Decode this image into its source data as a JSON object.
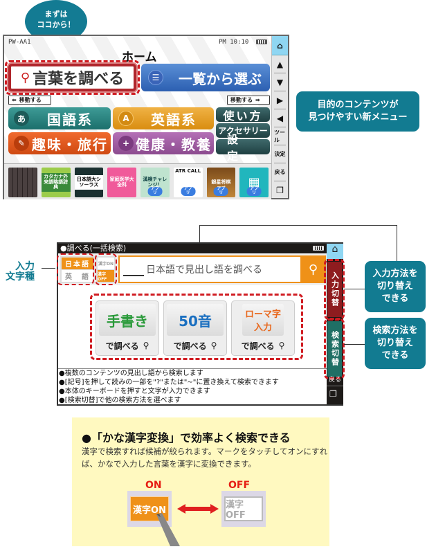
{
  "screen1": {
    "bubble_lines": [
      "まずは",
      "ココから！"
    ],
    "model": "PW-AA1",
    "time": "PM 10:10",
    "title": "ホーム",
    "search_button": "言葉を調べる",
    "list_button": "一覧から選ぶ",
    "move_left": "移動する",
    "move_right": "移動する",
    "categories": [
      {
        "icon": "あ",
        "label": "国語系"
      },
      {
        "icon": "A",
        "label": "英語系"
      },
      {
        "icon": "✎",
        "label": "趣味・旅行"
      },
      {
        "icon": "+",
        "label": "健康・教養"
      }
    ],
    "side_buttons": [
      "使い方",
      "アクセサリー",
      "設定"
    ],
    "shelf": [
      {
        "label": "",
        "app": ""
      },
      {
        "label": "カタカナ外来語略語辞典",
        "app": ""
      },
      {
        "label": "日本語大シソーラス",
        "app": ""
      },
      {
        "label": "家庭医学大全科",
        "app": ""
      },
      {
        "label": "漢検チャレンジ！",
        "app": "アプリ"
      },
      {
        "label": "ATR CALL",
        "app": "アプリ"
      },
      {
        "label": "銀星将棋",
        "app": "アプリ"
      },
      {
        "label": "",
        "app": "アプリ"
      }
    ],
    "sidebar": [
      "▲",
      "▼",
      "▶",
      "◀",
      "ツール",
      "決定",
      "戻る"
    ],
    "callout": [
      "目的のコンテンツが",
      "見つけやすい新メニュー"
    ]
  },
  "screen2": {
    "header": "●調べる(一括検索)",
    "label_input_type": [
      "入力",
      "文字種"
    ],
    "lang_japanese": "日本語",
    "lang_english": "英　語",
    "kanji_on": "漢字ON",
    "kanji_off": "漢字OFF",
    "search_placeholder": "日本語で見出し語を調べる",
    "methods": [
      {
        "label": "手書き",
        "action": "で調べる",
        "color": "#2a9a3a"
      },
      {
        "label": "50音",
        "action": "で調べる",
        "color": "#1a6fc0"
      },
      {
        "label": "ローマ字入力",
        "action": "で調べる",
        "color": "#e8661a"
      }
    ],
    "switch_input": "入力切替",
    "switch_search": "検索切替",
    "back": "戻る",
    "info": [
      "●複数のコンテンツの見出し語から検索します",
      "●[記号]を押して読みの一部を\"?\"または\"~\"に置き換えて検索できます",
      "●本体のキーボードを押すと文字が入力できます",
      "●[検索切替]で他の検索方法を選べます"
    ],
    "callout_input": [
      "入力方法を",
      "切り替え",
      "できる"
    ],
    "callout_search": [
      "検索方法を",
      "切り替え",
      "できる"
    ]
  },
  "panel": {
    "title": "●「かな漢字変換」で効率よく検索できる",
    "desc": "漢字で検索すれば候補が絞られます。マークをタッチしてオンにすれば、かなで入力した言葉を漢字に変換できます。",
    "on_label": "ON",
    "off_label": "OFF",
    "on_button": "漢字ON",
    "off_button": "漢字OFF"
  }
}
